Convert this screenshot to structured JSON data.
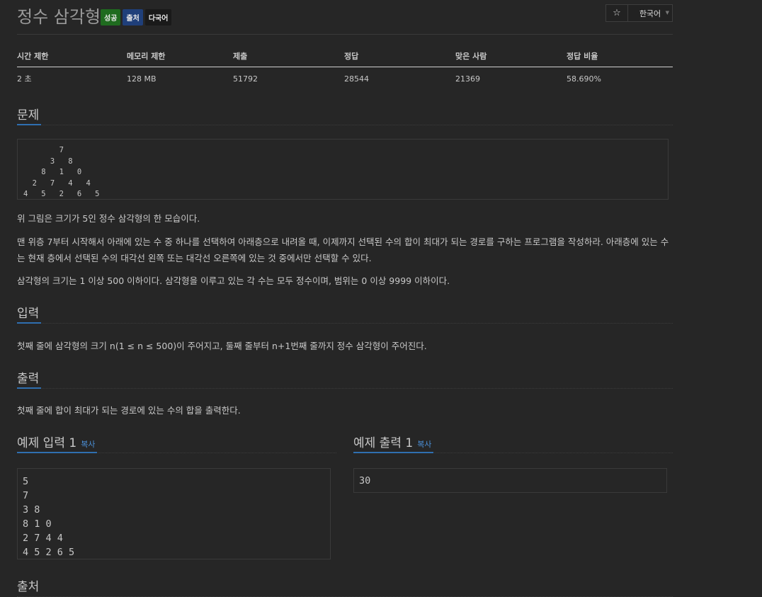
{
  "problem": {
    "title": "정수 삼각형",
    "labels": [
      {
        "text": "성공",
        "color": "#1f6b1f"
      },
      {
        "text": "출처",
        "color": "#1f3f7a"
      },
      {
        "text": "다국어",
        "color": "#1a1a1a"
      }
    ],
    "star_icon": "☆",
    "language": "한국어"
  },
  "info_table": {
    "headers": [
      "시간 제한",
      "메모리 제한",
      "제출",
      "정답",
      "맞은 사람",
      "정답 비율"
    ],
    "values": [
      "2 초",
      "128 MB",
      "51792",
      "28544",
      "21369",
      "58.690%"
    ]
  },
  "sections": {
    "description": {
      "heading": "문제",
      "figure": "        7\n      3   8\n    8   1   0\n  2   7   4   4\n4   5   2   6   5",
      "paragraphs": [
        "위 그림은 크기가 5인 정수 삼각형의 한 모습이다.",
        "맨 위층 7부터 시작해서 아래에 있는 수 중 하나를 선택하여 아래층으로 내려올 때, 이제까지 선택된 수의 합이 최대가 되는 경로를 구하는 프로그램을 작성하라. 아래층에 있는 수는 현재 층에서 선택된 수의 대각선 왼쪽 또는 대각선 오른쪽에 있는 것 중에서만 선택할 수 있다.",
        "삼각형의 크기는 1 이상 500 이하이다. 삼각형을 이루고 있는 각 수는 모두 정수이며, 범위는 0 이상 9999 이하이다."
      ]
    },
    "input": {
      "heading": "입력",
      "text": "첫째 줄에 삼각형의 크기 n(1 ≤ n ≤ 500)이 주어지고, 둘째 줄부터 n+1번째 줄까지 정수 삼각형이 주어진다."
    },
    "output": {
      "heading": "출력",
      "text": "첫째 줄에 합이 최대가 되는 경로에 있는 수의 합을 출력한다."
    },
    "sample_input": {
      "heading": "예제 입력 1",
      "copy_label": "복사",
      "content": "5\n7\n3 8\n8 1 0\n2 7 4 4\n4 5 2 6 5"
    },
    "sample_output": {
      "heading": "예제 출력 1",
      "copy_label": "복사",
      "content": "30"
    },
    "source": {
      "heading": "출처"
    }
  }
}
